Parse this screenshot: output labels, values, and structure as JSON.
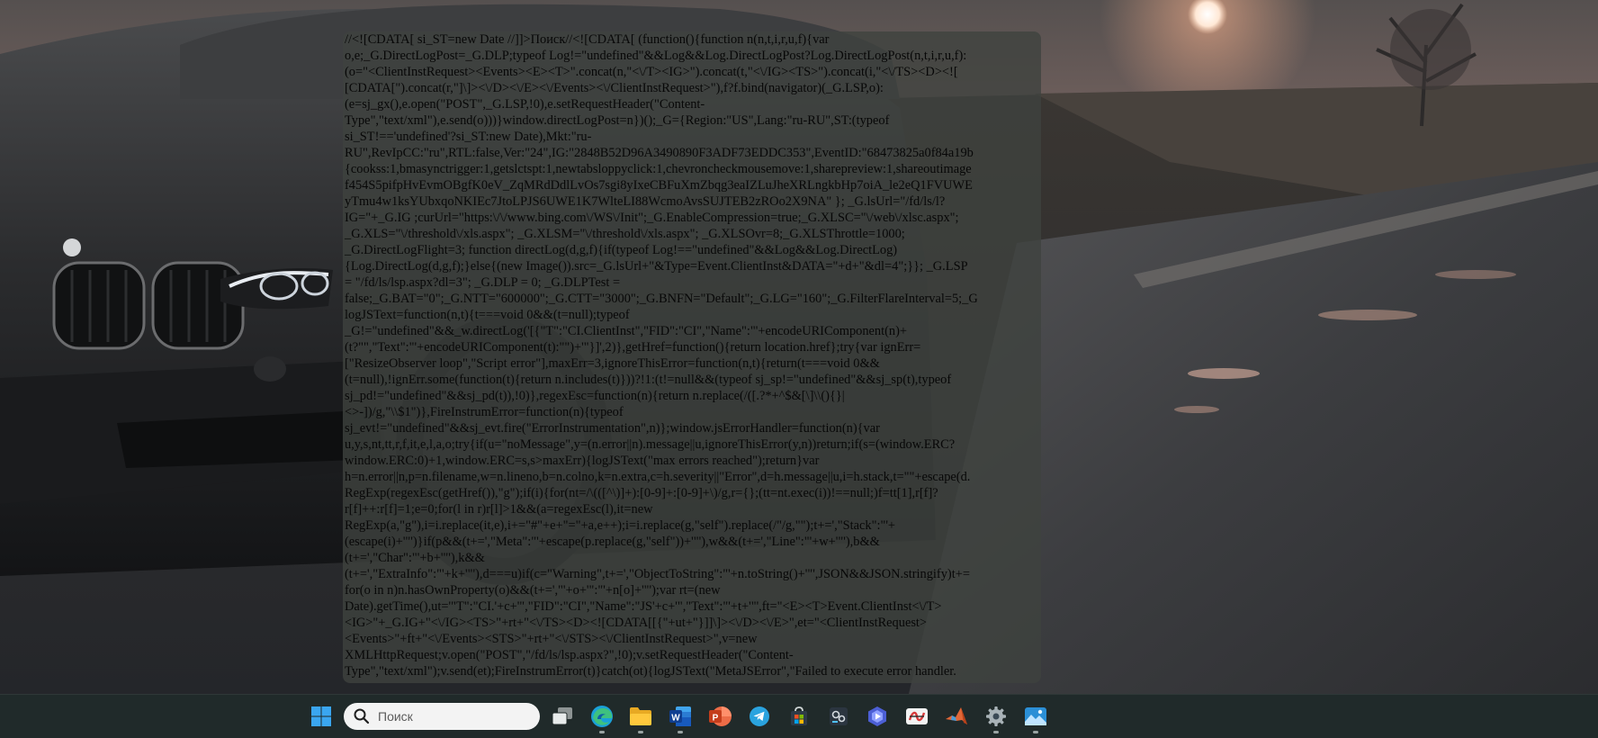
{
  "code_window": {
    "lines": [
      "//<![CDATA[ si_ST=new Date //]]>Поиск//<![CDATA[ (function(){function n(n,t,i,r,u,f){var",
      "o,e;_G.DirectLogPost=_G.DLP;typeof Log!=\"undefined\"&&Log&&Log.DirectLogPost?Log.DirectLogPost(n,t,i,r,u,f):",
      "(o=\"<ClientInstRequest><Events><E><T>\".concat(n,\"<\\/T><IG>\").concat(t,\"<\\/IG><TS>\").concat(i,\"<\\/TS><D><![",
      "[CDATA[\").concat(r,\"]\\]><\\/D><\\/E><\\/Events><\\/ClientInstRequest>\"),f?f.bind(navigator)(_G.LSP,o):",
      "(e=sj_gx(),e.open(\"POST\",_G.LSP,!0),e.setRequestHeader(\"Content-",
      "Type\",\"text/xml\"),e.send(o)))}window.directLogPost=n})();_G={Region:\"US\",Lang:\"ru-RU\",ST:(typeof",
      "si_ST!=='undefined'?si_ST:new Date),Mkt:\"ru-",
      "RU\",RevIpCC:\"ru\",RTL:false,Ver:\"24\",IG:\"2848B52D96A3490890F3ADF73EDDC353\",EventID:\"68473825a0f84a19b",
      "{cookss:1,bmasynctrigger:1,getslctspt:1,newtabsloppyclick:1,chevroncheckmousemove:1,sharepreview:1,shareoutimage",
      "f454S5pifpHvEvmOBgfK0eV_ZqMRdDdlLvOs7sgi8yIxeCBFuXmZbqg3eaIZLuJheXRLngkbHp7oiA_le2eQ1FVUWE",
      "yTmu4w1ksYUbxqoNKIEc7JtoLPJS6UWE1K7WlteLI88WcmoAvsSUJTEB2zROo2X9NA\" }; _G.lsUrl=\"/fd/ls/l?",
      "IG=\"+_G.IG ;curUrl=\"https:\\/\\/www.bing.com\\/WS\\/Init\";_G.EnableCompression=true;_G.XLSC=\"\\/web\\/xlsc.aspx\";",
      "_G.XLS=\"\\/threshold\\/xls.aspx\"; _G.XLSM=\"\\/threshold\\/xls.aspx\"; _G.XLSOvr=8;_G.XLSThrottle=1000;",
      "_G.DirectLogFlight=3; function directLog(d,g,f){if(typeof Log!==\"undefined\"&&Log&&Log.DirectLog)",
      "{Log.DirectLog(d,g,f);}else{(new Image()).src=_G.lsUrl+\"&Type=Event.ClientInst&DATA=\"+d+\"&dl=4\";}}; _G.LSP",
      "= \"/fd/ls/lsp.aspx?dl=3\"; _G.DLP = 0; _G.DLPTest =",
      "false;_G.BAT=\"0\";_G.NTT=\"600000\";_G.CTT=\"3000\";_G.BNFN=\"Default\";_G.LG=\"160\";_G.FilterFlareInterval=5;_G",
      "logJSText=function(n,t){t===void 0&&(t=null);typeof",
      "_G!=\"undefined\"&&_w.directLog('[{\"T\":\"CI.ClientInst\",\"FID\":\"CI\",\"Name\":\"'+encodeURIComponent(n)+",
      "(t?\"\",\"Text\":\"'+encodeURIComponent(t):\"\")+'\"}]',2)},getHref=function(){return location.href};try{var ignErr=",
      "[\"ResizeObserver loop\",\"Script error\"],maxErr=3,ignoreThisError=function(n,t){return(t===void 0&&",
      "(t=null),!ignErr.some(function(t){return n.includes(t)}))?!1:(t!=null&&(typeof sj_sp!=\"undefined\"&&sj_sp(t),typeof",
      "sj_pd!=\"undefined\"&&sj_pd(t)),!0)},regexEsc=function(n){return n.replace(/([.?*+^$&[\\]\\\\(){}|",
      "<>-])/g,\"\\\\$1\")},FireInstrumError=function(n){typeof",
      "sj_evt!=\"undefined\"&&sj_evt.fire(\"ErrorInstrumentation\",n)};window.jsErrorHandler=function(n){var",
      "u,y,s,nt,tt,r,f,it,e,l,a,o;try{if(u=\"noMessage\",y=(n.error||n).message||u,ignoreThisError(y,n))return;if(s=(window.ERC?",
      "window.ERC:0)+1,window.ERC=s,s>maxErr){logJSText(\"max errors reached\");return}var",
      "h=n.error||n,p=n.filename,w=n.lineno,b=n.colno,k=n.extra,c=h.severity||\"Error\",d=h.message||u,i=h.stack,t=\"\"+escape(d.",
      "RegExp(regexEsc(getHref()),\"g\");if(i){for(nt=/\\(([^\\)]+):[0-9]+:[0-9]+\\)/g,r={};(tt=nt.exec(i))!==null;)f=tt[1],r[f]?",
      "r[f]++:r[f]=1;e=0;for(l in r)r[l]>1&&(a=regexEsc(l),it=new",
      "RegExp(a,\"g\"),i=i.replace(it,e),i+=\"#\"+e+\"=\"+a,e++);i=i.replace(g,\"self\").replace(/\"/g,\"\");t+=',\"Stack\":\"'+",
      "(escape(i)+'\"')}if(p&&(t+=',\"Meta\":\"'+escape(p.replace(g,\"self\"))+'\"'),w&&(t+=',\"Line\":\"'+w+'\"'),b&&",
      "(t+=',\"Char\":\"'+b+'\"'),k&&",
      "(t+=',\"ExtraInfo\":\"'+k+'\"'),d===u)if(c=\"Warning\",t+=',\"ObjectToString\":\"'+n.toString()+'\"',JSON&&JSON.stringify)t+=",
      "for(o in n)n.hasOwnProperty(o)&&(t+=',\"'+o+'\":\"'+n[o]+'\"');var rt=(new",
      "Date).getTime(),ut='\"T\":\"CI.'+c+'\",\"FID\":\"CI\",\"Name\":\"JS'+c+'\",\"Text\":\"'+t+'\"',ft=\"<E><T>Event.ClientInst<\\/T>",
      "<IG>\"+_G.IG+\"<\\/IG><TS>\"+rt+\"<\\/TS><D><![CDATA[[{\"+ut+\"}]]\\]><\\/D><\\/E>\",et=\"<ClientInstRequest>",
      "<Events>\"+ft+\"<\\/Events><STS>\"+rt+\"<\\/STS><\\/ClientInstRequest>\",v=new",
      "XMLHttpRequest;v.open(\"POST\",\"/fd/ls/lsp.aspx?\",!0);v.setRequestHeader(\"Content-",
      "Type\",\"text/xml\");v.send(et);FireInstrumError(t)}catch(ot){logJSText(\"MetaJSError\",\"Failed to execute error handler."
    ]
  },
  "taskbar": {
    "search": {
      "placeholder": "Поиск",
      "icon": "search-icon"
    },
    "items": [
      {
        "name": "start-button",
        "icon": "windows-logo-icon",
        "running": false
      },
      {
        "name": "task-view-button",
        "icon": "task-view-icon",
        "running": false
      },
      {
        "name": "edge-button",
        "icon": "edge-icon",
        "running": true
      },
      {
        "name": "file-explorer-button",
        "icon": "folder-icon",
        "running": true
      },
      {
        "name": "word-button",
        "icon": "word-icon",
        "running": true
      },
      {
        "name": "powerpoint-button",
        "icon": "powerpoint-icon",
        "running": false
      },
      {
        "name": "telegram-button",
        "icon": "telegram-icon",
        "running": false
      },
      {
        "name": "store-button",
        "icon": "store-icon",
        "running": false
      },
      {
        "name": "app-button-1",
        "icon": "app-icon",
        "running": false
      },
      {
        "name": "app-button-2",
        "icon": "app-icon",
        "running": false
      },
      {
        "name": "app-button-3",
        "icon": "app-icon",
        "running": false
      },
      {
        "name": "matlab-button",
        "icon": "matlab-icon",
        "running": false
      },
      {
        "name": "settings-button",
        "icon": "gear-icon",
        "running": true
      },
      {
        "name": "photos-button",
        "icon": "photos-icon",
        "running": true
      }
    ]
  },
  "colors": {
    "overlay": "#3e423e",
    "code_text": "#070707",
    "taskbar": "#202a2a"
  }
}
